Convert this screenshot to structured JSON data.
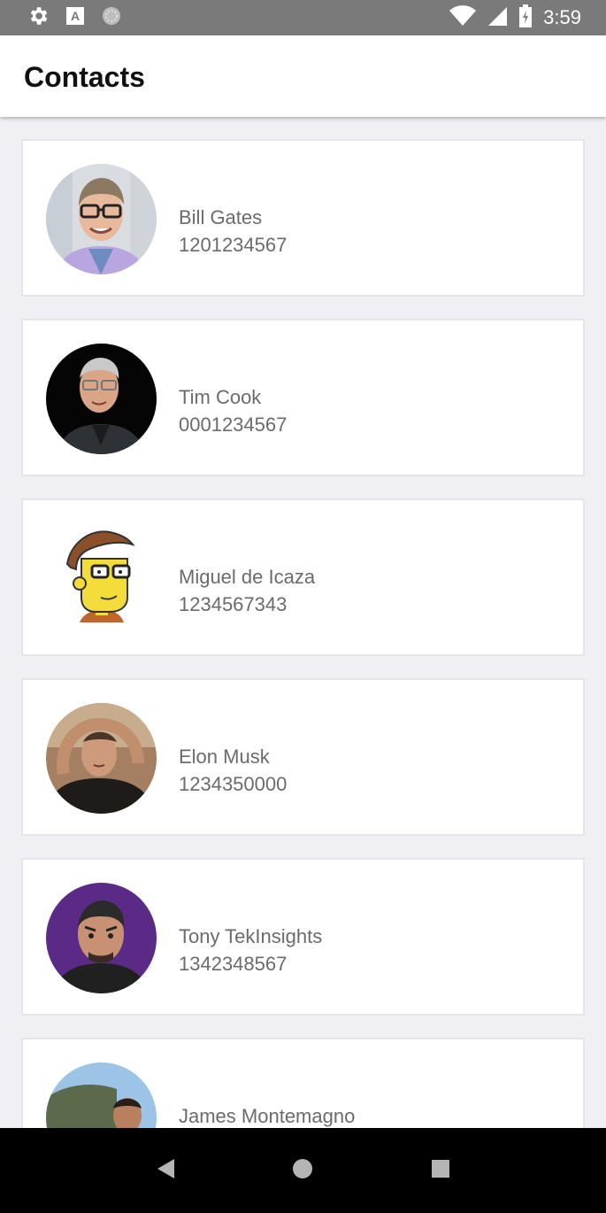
{
  "status_bar": {
    "icons": [
      "gear-icon",
      "text-icon",
      "sync-icon",
      "wifi-icon",
      "signal-icon",
      "battery-charging-icon"
    ],
    "time": "3:59"
  },
  "app_bar": {
    "title": "Contacts"
  },
  "contacts": [
    {
      "name": "Bill Gates",
      "phone": "1201234567"
    },
    {
      "name": "Tim Cook",
      "phone": "0001234567"
    },
    {
      "name": "Miguel de Icaza",
      "phone": "1234567343"
    },
    {
      "name": "Elon Musk",
      "phone": "1234350000"
    },
    {
      "name": "Tony TekInsights",
      "phone": "1342348567"
    },
    {
      "name": "James Montemagno",
      "phone": ""
    }
  ],
  "nav_bar": {
    "icons": [
      "back-icon",
      "home-icon",
      "recents-icon"
    ]
  }
}
